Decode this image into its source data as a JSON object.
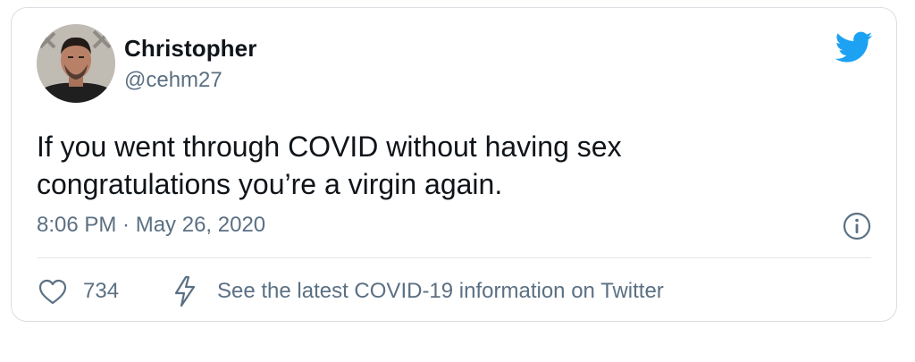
{
  "tweet": {
    "author": {
      "display_name": "Christopher",
      "handle": "@cehm27"
    },
    "text": "If you went through COVID without having sex\ncongratulations you’re a virgin again.",
    "timestamp": "8:06 PM · May 26, 2020",
    "like_count": "734",
    "covid_link": "See the latest COVID-19 information on Twitter"
  },
  "icons": {
    "brand": "twitter-bird-icon",
    "info": "info-icon",
    "like": "heart-icon",
    "covid": "lightning-bolt-icon"
  },
  "colors": {
    "brand_blue": "#1da1f2",
    "secondary_text": "#5b7083",
    "primary_text": "#0f1419",
    "border": "#dadde1"
  }
}
